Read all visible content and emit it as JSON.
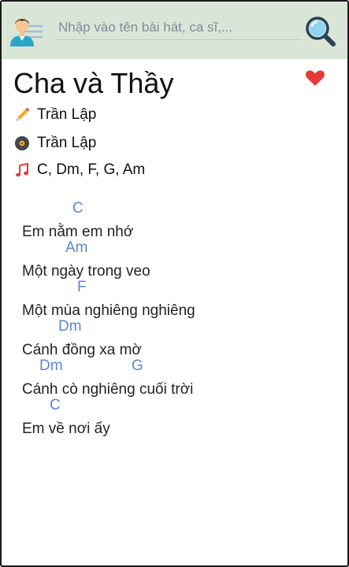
{
  "search": {
    "placeholder": "Nhập vào tên bài hát, ca sĩ,..."
  },
  "song": {
    "title": "Cha và Thầy",
    "composer": "Trần Lập",
    "singer": "Trần Lập",
    "chords": "C, Dm, F, G, Am"
  },
  "lyrics": [
    {
      "chords": [
        "C"
      ],
      "text": "Em nằm em nhớ"
    },
    {
      "chords": [
        "Am"
      ],
      "text": "Một ngày trong veo"
    },
    {
      "chords": [
        "F"
      ],
      "text": "Một mùa nghiêng nghiêng"
    },
    {
      "chords": [
        "Dm"
      ],
      "text": "Cánh đồng xa mờ"
    },
    {
      "chords": [
        "Dm",
        "G"
      ],
      "text": "Cánh cò nghiêng cuối trời"
    },
    {
      "chords": [
        "C"
      ],
      "text": "Em về nơi ấy"
    }
  ],
  "icons": {
    "avatar": "user-menu-icon",
    "search": "search-icon",
    "favorite": "heart-icon",
    "composer": "pencil-icon",
    "singer": "vinyl-icon",
    "chords": "music-note-icon"
  },
  "colors": {
    "header_bg": "#d9e6d7",
    "chord": "#5b86d6",
    "heart": "#e53935"
  }
}
